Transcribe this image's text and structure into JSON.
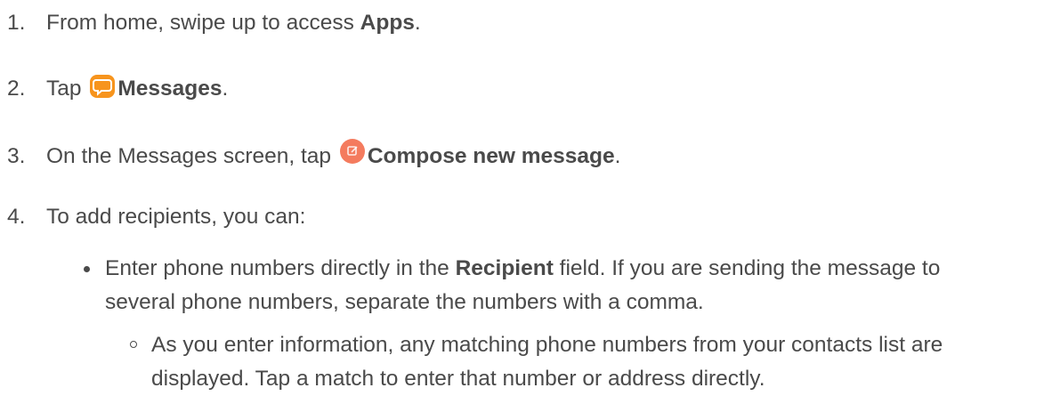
{
  "steps": [
    {
      "number": "1.",
      "text_before": "From home, swipe up to access ",
      "bold": "Apps",
      "text_after": "."
    },
    {
      "number": "2.",
      "text_before": "Tap ",
      "icon": "messages-app-icon",
      "bold": "Messages",
      "text_after": "."
    },
    {
      "number": "3.",
      "text_before": "On the Messages screen, tap ",
      "icon": "compose-new-message-icon",
      "bold": "Compose new message",
      "text_after": "."
    },
    {
      "number": "4.",
      "text": "To add recipients, you can:"
    }
  ],
  "bullet": {
    "text_before": "Enter phone numbers directly in the ",
    "bold": "Recipient",
    "text_after_line1": " field. If you are sending the message to",
    "line2": "several phone numbers, separate the numbers with a comma."
  },
  "sub_bullet": {
    "line1": "As you enter information, any matching phone numbers from your contacts list are",
    "line2": "displayed. Tap a match to enter that number or address directly."
  },
  "colors": {
    "text": "#4a4a4a",
    "messages_icon": "#f7941d",
    "compose_icon": "#f47b5e"
  }
}
